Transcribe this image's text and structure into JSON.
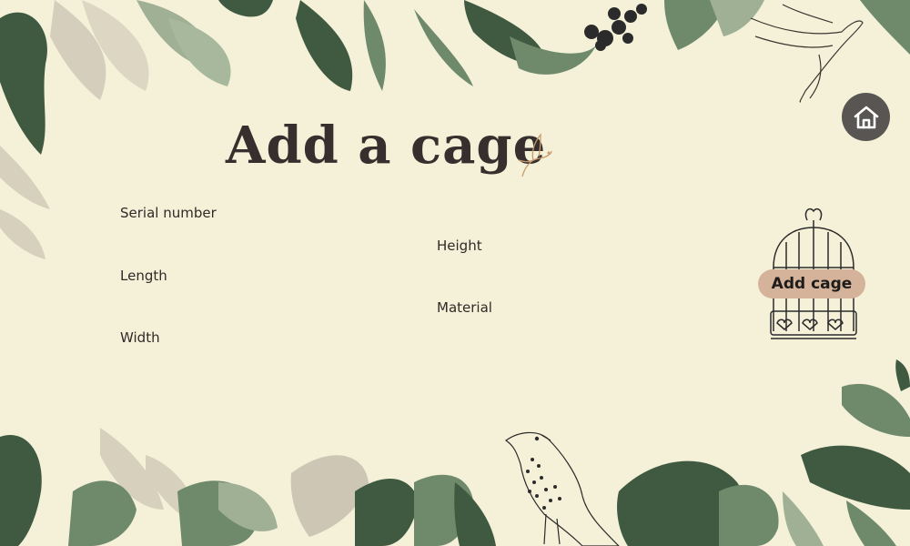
{
  "page": {
    "title": "Add a cage"
  },
  "form": {
    "serial_number_label": "Serial number",
    "length_label": "Length",
    "width_label": "Width",
    "height_label": "Height",
    "material_label": "Material",
    "serial_number_value": "",
    "length_value": "",
    "width_value": "",
    "height_value": "",
    "material_value": ""
  },
  "actions": {
    "add_cage_label": "Add cage",
    "home_icon": "home-icon"
  },
  "colors": {
    "background": "#f4f1d8",
    "leaf_dark": "#3f5a41",
    "leaf_mid": "#6e8a6b",
    "leaf_light": "#9fb094",
    "leaf_beige": "#cdc6b5",
    "button": "#d4b39a",
    "home_button": "#585553",
    "text": "#2e2b28"
  }
}
